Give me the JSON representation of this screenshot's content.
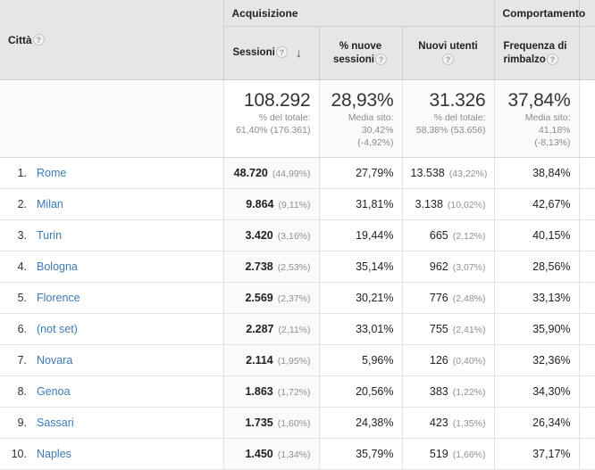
{
  "table": {
    "dimension_header": {
      "label": "Città",
      "help_icon": "help-icon",
      "help_glyph": "?"
    },
    "group_headers": [
      {
        "label": "Acquisizione",
        "span": 3
      },
      {
        "label": "Comportamento",
        "span": 1
      }
    ],
    "metric_headers": [
      {
        "line1": "Sessioni",
        "line2": "",
        "help_glyph": "?",
        "sorted": true,
        "sort_direction": "descending",
        "sort_glyph": "↓"
      },
      {
        "line1": "% nuove",
        "line2": "sessioni",
        "help_glyph": "?",
        "sorted": false
      },
      {
        "line1": "Nuovi utenti",
        "line2": "",
        "help_glyph": "?",
        "sorted": false
      },
      {
        "line1": "Frequenza di",
        "line2": "rimbalzo",
        "help_glyph": "?",
        "sorted": false
      }
    ],
    "summary": {
      "sessions": {
        "value": "108.292",
        "sub_label": "% del totale:",
        "sub_value": "61,40% (176.361)"
      },
      "new_sessions_pct": {
        "value": "28,93%",
        "sub_label": "Media sito:",
        "sub_value": "30,42%",
        "sub_delta": "(-4,92%)"
      },
      "new_users": {
        "value": "31.326",
        "sub_label": "% del totale:",
        "sub_value": "58,38% (53.656)"
      },
      "bounce_rate": {
        "value": "37,84%",
        "sub_label": "Media sito:",
        "sub_value": "41,18%",
        "sub_delta": "(-8,13%)"
      }
    },
    "rows": [
      {
        "index": "1.",
        "city": "Rome",
        "sessions": "48.720",
        "sessions_pct": "(44,99%)",
        "new_sessions_pct": "27,79%",
        "new_users": "13.538",
        "new_users_pct": "(43,22%)",
        "bounce_rate": "38,84%"
      },
      {
        "index": "2.",
        "city": "Milan",
        "sessions": "9.864",
        "sessions_pct": "(9,11%)",
        "new_sessions_pct": "31,81%",
        "new_users": "3.138",
        "new_users_pct": "(10,02%)",
        "bounce_rate": "42,67%"
      },
      {
        "index": "3.",
        "city": "Turin",
        "sessions": "3.420",
        "sessions_pct": "(3,16%)",
        "new_sessions_pct": "19,44%",
        "new_users": "665",
        "new_users_pct": "(2,12%)",
        "bounce_rate": "40,15%"
      },
      {
        "index": "4.",
        "city": "Bologna",
        "sessions": "2.738",
        "sessions_pct": "(2,53%)",
        "new_sessions_pct": "35,14%",
        "new_users": "962",
        "new_users_pct": "(3,07%)",
        "bounce_rate": "28,56%"
      },
      {
        "index": "5.",
        "city": "Florence",
        "sessions": "2.569",
        "sessions_pct": "(2,37%)",
        "new_sessions_pct": "30,21%",
        "new_users": "776",
        "new_users_pct": "(2,48%)",
        "bounce_rate": "33,13%"
      },
      {
        "index": "6.",
        "city": "(not set)",
        "sessions": "2.287",
        "sessions_pct": "(2,11%)",
        "new_sessions_pct": "33,01%",
        "new_users": "755",
        "new_users_pct": "(2,41%)",
        "bounce_rate": "35,90%"
      },
      {
        "index": "7.",
        "city": "Novara",
        "sessions": "2.114",
        "sessions_pct": "(1,95%)",
        "new_sessions_pct": "5,96%",
        "new_users": "126",
        "new_users_pct": "(0,40%)",
        "bounce_rate": "32,36%"
      },
      {
        "index": "8.",
        "city": "Genoa",
        "sessions": "1.863",
        "sessions_pct": "(1,72%)",
        "new_sessions_pct": "20,56%",
        "new_users": "383",
        "new_users_pct": "(1,22%)",
        "bounce_rate": "34,30%"
      },
      {
        "index": "9.",
        "city": "Sassari",
        "sessions": "1.735",
        "sessions_pct": "(1,60%)",
        "new_sessions_pct": "24,38%",
        "new_users": "423",
        "new_users_pct": "(1,35%)",
        "bounce_rate": "26,34%"
      },
      {
        "index": "10.",
        "city": "Naples",
        "sessions": "1.450",
        "sessions_pct": "(1,34%)",
        "new_sessions_pct": "35,79%",
        "new_users": "519",
        "new_users_pct": "(1,66%)",
        "bounce_rate": "37,17%"
      }
    ]
  },
  "colors": {
    "link": "#3d7ab8",
    "header_bg": "#e6e6e6",
    "sorted_col_bg": "#fafafa",
    "muted_text": "#909090"
  }
}
